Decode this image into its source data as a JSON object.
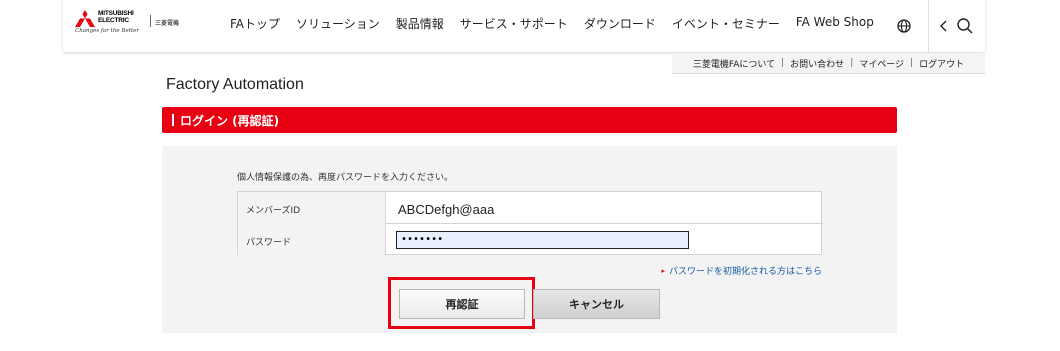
{
  "header": {
    "logo": {
      "brand_line1": "MITSUBISHI",
      "brand_line2": "ELECTRIC",
      "sub": "三菱電機",
      "tagline": "Changes for the Better"
    },
    "nav": [
      "FAトップ",
      "ソリューション",
      "製品情報",
      "サービス・サポート",
      "ダウンロード",
      "イベント・セミナー",
      "FA Web Shop"
    ],
    "icons": {
      "globe": "globe-icon",
      "back": "chevron-left-icon",
      "search": "search-icon"
    }
  },
  "sublinks": [
    "三菱電機FAについて",
    "お問い合わせ",
    "マイページ",
    "ログアウト"
  ],
  "page_title": "Factory Automation",
  "section_title": "ログイン (再認証)",
  "form": {
    "notice": "個人情報保護の為、再度パスワードを入力ください。",
    "member_id_label": "メンバーズID",
    "member_id_value": "ABCDefgh@aaa",
    "password_label": "パスワード",
    "password_value": "•••••••",
    "forgot_link": "パスワードを初期化される方はこちら"
  },
  "buttons": {
    "reauth": "再認証",
    "cancel": "キャンセル"
  },
  "colors": {
    "accent_red": "#e60012",
    "link_blue": "#1a5aa6",
    "panel_bg": "#f3f3f3"
  }
}
